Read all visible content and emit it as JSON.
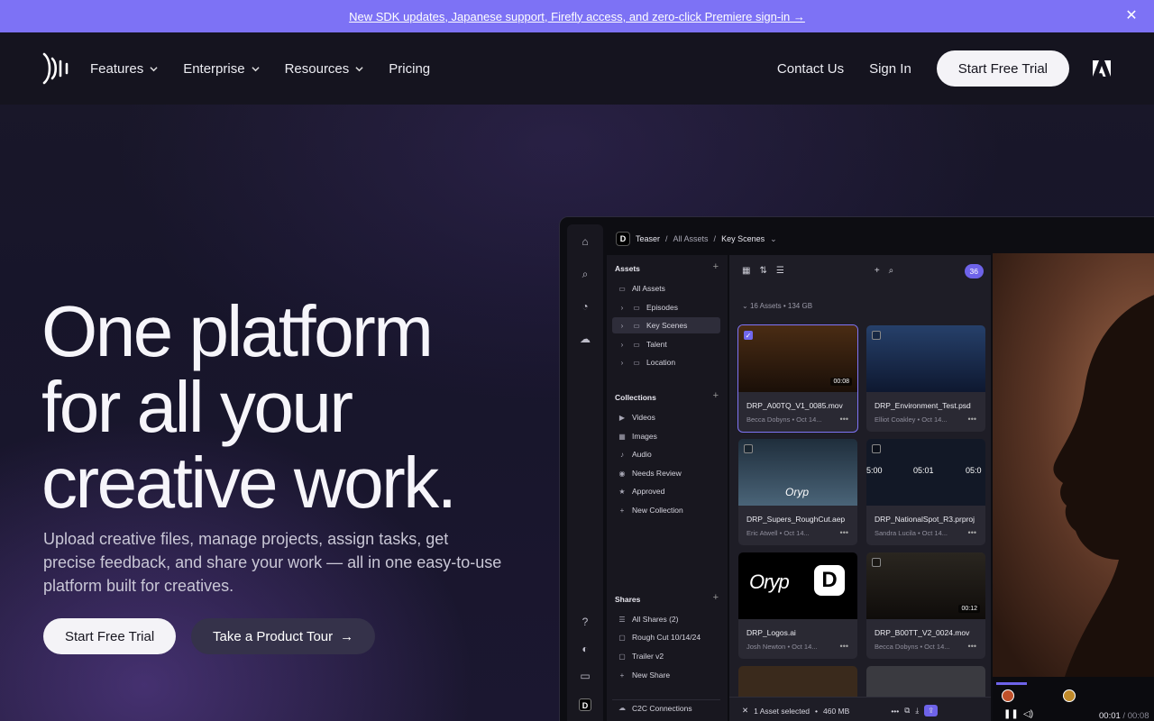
{
  "announcement": {
    "text": "New SDK updates, Japanese support, Firefly access, and zero-click Premiere sign-in →",
    "close_icon": "✕"
  },
  "nav": {
    "items": [
      {
        "label": "Features",
        "dropdown": true
      },
      {
        "label": "Enterprise",
        "dropdown": true
      },
      {
        "label": "Resources",
        "dropdown": true
      },
      {
        "label": "Pricing",
        "dropdown": false
      }
    ],
    "contact": "Contact Us",
    "signin": "Sign In",
    "trial": "Start Free Trial"
  },
  "hero": {
    "title_lines": [
      "One platform",
      "for all your",
      "creative work."
    ],
    "subtitle": "Upload creative files, manage projects, assign tasks, get precise feedback, and share your work — all in one easy-to-use platform built for creatives.",
    "cta_primary": "Start Free Trial",
    "cta_secondary": "Take a Product Tour",
    "cta_arrow": "→"
  },
  "app": {
    "breadcrumb": {
      "project": "Teaser",
      "sep": "/",
      "mid": "All Assets",
      "current": "Key Scenes"
    },
    "assets_header": "Assets",
    "folders": [
      {
        "label": "All Assets",
        "active": false
      },
      {
        "label": "Episodes",
        "active": false
      },
      {
        "label": "Key Scenes",
        "active": true
      },
      {
        "label": "Talent",
        "active": false
      },
      {
        "label": "Location",
        "active": false
      }
    ],
    "collections_header": "Collections",
    "collections": [
      {
        "label": "Videos",
        "icon": "▶"
      },
      {
        "label": "Images",
        "icon": "▦"
      },
      {
        "label": "Audio",
        "icon": "♪"
      },
      {
        "label": "Needs Review",
        "icon": "◉"
      },
      {
        "label": "Approved",
        "icon": "★"
      },
      {
        "label": "New Collection",
        "icon": "+"
      }
    ],
    "shares_header": "Shares",
    "shares": [
      {
        "label": "All Shares (2)",
        "icon": "☰"
      },
      {
        "label": "Rough Cut 10/14/24",
        "icon": "▢"
      },
      {
        "label": "Trailer v2",
        "icon": "▢"
      },
      {
        "label": "New Share",
        "icon": "+"
      }
    ],
    "connections": "C2C Connections",
    "member_count": "36",
    "assets_meta": "16 Assets",
    "assets_size": "134 GB",
    "cards": [
      {
        "name": "DRP_A00TQ_V1_0085.mov",
        "who": "Becca Dobyns",
        "date": "Oct 14...",
        "duration": "00:08",
        "selected": true,
        "thumb": "#3a2414"
      },
      {
        "name": "DRP_Environment_Test.psd",
        "who": "Elliot Coakley",
        "date": "Oct 14...",
        "duration": "",
        "selected": false,
        "thumb": "#1a2a48"
      },
      {
        "name": "DRP_Supers_RoughCut.aep",
        "who": "Eric Atwell",
        "date": "Oct 14...",
        "duration": "",
        "selected": false,
        "thumb": "#243444"
      },
      {
        "name": "DRP_NationalSpot_R3.prproj",
        "who": "Sandra Lucila",
        "date": "Oct 14...",
        "duration": "",
        "selected": false,
        "thumb": "#141a26"
      },
      {
        "name": "DRP_Logos.ai",
        "who": "Josh Newton",
        "date": "Oct 14...",
        "duration": "",
        "selected": false,
        "thumb": "#000000"
      },
      {
        "name": "DRP_B00TT_V2_0024.mov",
        "who": "Becca Dobyns",
        "date": "Oct 14...",
        "duration": "00:12",
        "selected": false,
        "thumb": "#2a2218"
      }
    ],
    "thumb_labels": {
      "oryp": "Oryp",
      "logo_mark": "D",
      "timecodes": [
        "5:00",
        "05:01",
        "05:0"
      ]
    },
    "selection_bar": {
      "label": "1 Asset selected",
      "size": "460 MB"
    },
    "player": {
      "current": "00:01",
      "sep": "/",
      "total": "00:08"
    }
  },
  "colors": {
    "accent": "#7d72f5",
    "nav_bg": "#15141f",
    "cta_secondary_bg": "#35324a"
  }
}
